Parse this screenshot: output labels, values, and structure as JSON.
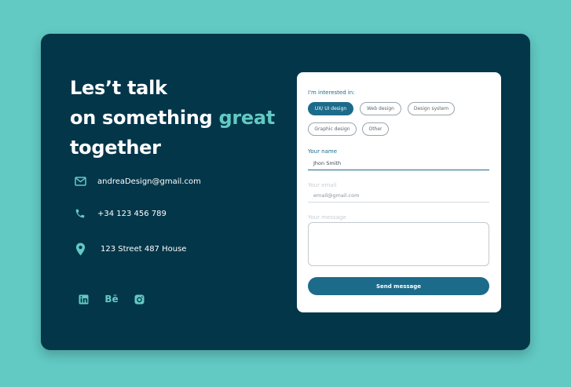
{
  "headline": {
    "line1": "Les’t talk",
    "line2_prefix": "on something ",
    "line2_accent": "great",
    "line3": "together"
  },
  "contacts": {
    "email": "andreaDesign@gmail.com",
    "phone": "+34 123 456 789",
    "address": "123 Street 487 House"
  },
  "social": {
    "linkedin_icon": "linkedin-icon",
    "behance_label": "Bē",
    "instagram_icon": "instagram-icon"
  },
  "form": {
    "interest_label": "I'm interested in:",
    "chips": [
      {
        "label": "UX/ UI design",
        "active": true
      },
      {
        "label": "Web design",
        "active": false
      },
      {
        "label": "Design system",
        "active": false
      },
      {
        "label": "Graphic design",
        "active": false
      },
      {
        "label": "Other",
        "active": false
      }
    ],
    "name_label": "Your name",
    "name_value": "Jhon Smith",
    "email_label": "Your email",
    "email_value": "email@gmail.com",
    "message_label": "Your message",
    "send_label": "Send message"
  },
  "colors": {
    "background": "#62c9c3",
    "card": "#04364a",
    "accent": "#62c9c3",
    "button": "#1c6b8a"
  }
}
